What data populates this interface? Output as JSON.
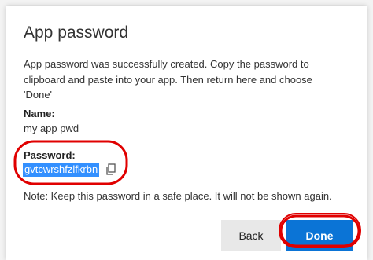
{
  "dialog": {
    "title": "App password",
    "message": "App password was successfully created. Copy the password to clipboard and paste into your app. Then return here and choose 'Done'",
    "name_label": "Name:",
    "name_value": "my app pwd",
    "password_label": "Password:",
    "password_value": "gvtcwrshfzlfkrbn",
    "copy_icon": "copy-icon",
    "note": "Note: Keep this password in a safe place. It will not be shown again.",
    "back_label": "Back",
    "done_label": "Done"
  },
  "colors": {
    "primary_button": "#0b74d6",
    "selection_highlight": "#3390ff",
    "annotation_red": "#e00000",
    "secondary_button": "#e8e8e8"
  }
}
